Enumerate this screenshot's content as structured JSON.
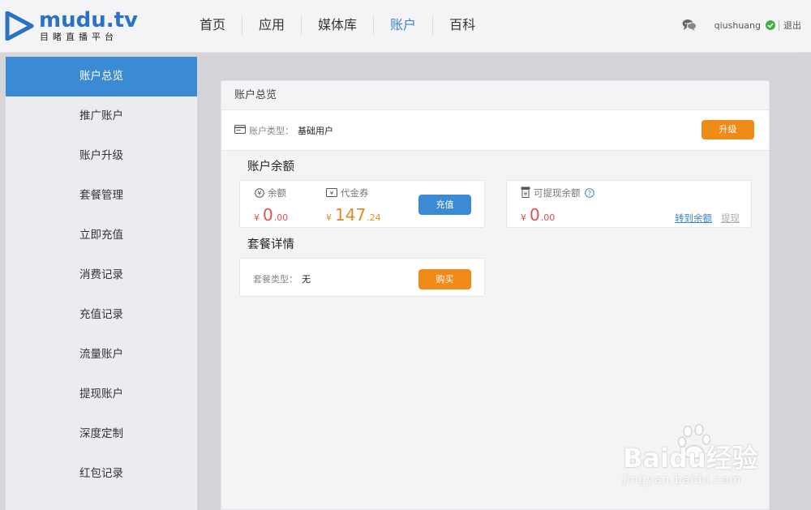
{
  "brand": {
    "name": "mudu.tv",
    "tagline": "目睹直播平台",
    "color": "#2b71c7"
  },
  "nav": {
    "items": [
      {
        "label": "首页",
        "active": false
      },
      {
        "label": "应用",
        "active": false
      },
      {
        "label": "媒体库",
        "active": false
      },
      {
        "label": "账户",
        "active": true
      },
      {
        "label": "百科",
        "active": false
      }
    ]
  },
  "user": {
    "chat_icon": "chat-bubbles-icon",
    "name": "qiushuang",
    "verified_icon": "check-circle-icon",
    "logout_label": "退出"
  },
  "sidebar": {
    "items": [
      {
        "label": "账户总览"
      },
      {
        "label": "推广账户"
      },
      {
        "label": "账户升级"
      },
      {
        "label": "套餐管理"
      },
      {
        "label": "立即充值"
      },
      {
        "label": "消费记录"
      },
      {
        "label": "充值记录"
      },
      {
        "label": "流量账户"
      },
      {
        "label": "提现账户"
      },
      {
        "label": "深度定制"
      },
      {
        "label": "红包记录"
      }
    ],
    "active_index": 0
  },
  "overview": {
    "title": "账户总览",
    "account_type_label": "账户类型：",
    "account_type_value": "基础用户",
    "upgrade_label": "升级",
    "balance_section_title": "账户余额",
    "balance": {
      "label": "余额",
      "currency": "¥",
      "integer": "0",
      "decimal": ".00"
    },
    "voucher": {
      "label": "代金券",
      "currency": "¥",
      "integer": "147",
      "decimal": ".24"
    },
    "recharge_label": "充值",
    "withdrawable": {
      "label": "可提现余额",
      "currency": "¥",
      "integer": "0",
      "decimal": ".00",
      "transfer_label": "转到余额",
      "withdraw_label": "提现"
    },
    "package_section_title": "套餐详情",
    "package_type_label": "套餐类型：",
    "package_type_value": "无",
    "buy_label": "购买"
  },
  "watermark": {
    "text": "Baidu经验",
    "sub": "jingyan.baidu.com"
  },
  "colors": {
    "accent_blue": "#3a8ad4",
    "accent_orange": "#f08a18",
    "amount_red": "#d9534f",
    "amount_orange": "#e08c2b"
  }
}
